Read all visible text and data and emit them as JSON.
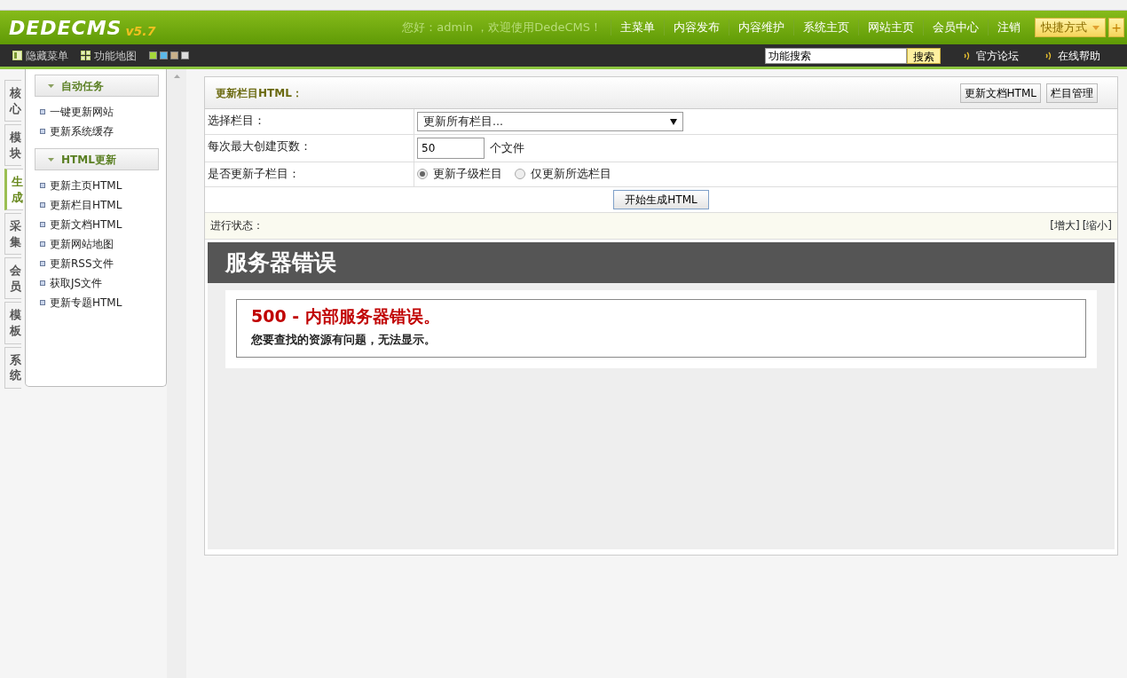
{
  "header": {
    "logo": "DEDECMS",
    "version": "v5.7",
    "welcome": "您好：admin ，欢迎使用DedeCMS！",
    "nav": [
      "主菜单",
      "内容发布",
      "内容维护",
      "系统主页",
      "网站主页",
      "会员中心",
      "注销"
    ],
    "quick_menu": "快捷方式",
    "add_button": "+"
  },
  "toolbar": {
    "links": [
      "隐藏菜单",
      "功能地图"
    ],
    "themes": [
      {
        "color": "#a6d83a"
      },
      {
        "color": "#5cb8e8"
      },
      {
        "color": "#c8b08a"
      },
      {
        "color": "#dddddd"
      }
    ],
    "search_value": "功能搜索",
    "search_button": "搜索",
    "help_links": [
      "官方论坛",
      "在线帮助"
    ]
  },
  "side_tabs": [
    {
      "label": "核心",
      "selected": false
    },
    {
      "label": "模块",
      "selected": false
    },
    {
      "label": "生成",
      "selected": true
    },
    {
      "label": "采集",
      "selected": false
    },
    {
      "label": "会员",
      "selected": false
    },
    {
      "label": "模板",
      "selected": false
    },
    {
      "label": "系统",
      "selected": false
    }
  ],
  "menu_groups": [
    {
      "title": "自动任务",
      "items": [
        "一键更新网站",
        "更新系统缓存"
      ]
    },
    {
      "title": "HTML更新",
      "items": [
        "更新主页HTML",
        "更新栏目HTML",
        "更新文档HTML",
        "更新网站地图",
        "更新RSS文件",
        "获取JS文件",
        "更新专题HTML"
      ]
    }
  ],
  "panel": {
    "title": "更新栏目HTML：",
    "buttons": [
      "更新文档HTML",
      "栏目管理"
    ],
    "form": [
      {
        "kind": "select",
        "label": "选择栏目：",
        "value": "更新所有栏目..."
      },
      {
        "kind": "input",
        "label": "每次最大创建页数：",
        "value": "50",
        "suffix": "个文件"
      },
      {
        "kind": "radio",
        "label": "是否更新子栏目：",
        "options": [
          {
            "label": "更新子级栏目",
            "selected": true
          },
          {
            "label": "仅更新所选栏目",
            "selected": false
          }
        ]
      }
    ],
    "submit": "开始生成HTML",
    "status_label": "进行状态：",
    "zoom_links": [
      "[增大]",
      "[缩小]"
    ],
    "error": {
      "heading": "服务器错误",
      "title": "500 - 内部服务器错误。",
      "message": "您要查找的资源有问题，无法显示。"
    }
  }
}
